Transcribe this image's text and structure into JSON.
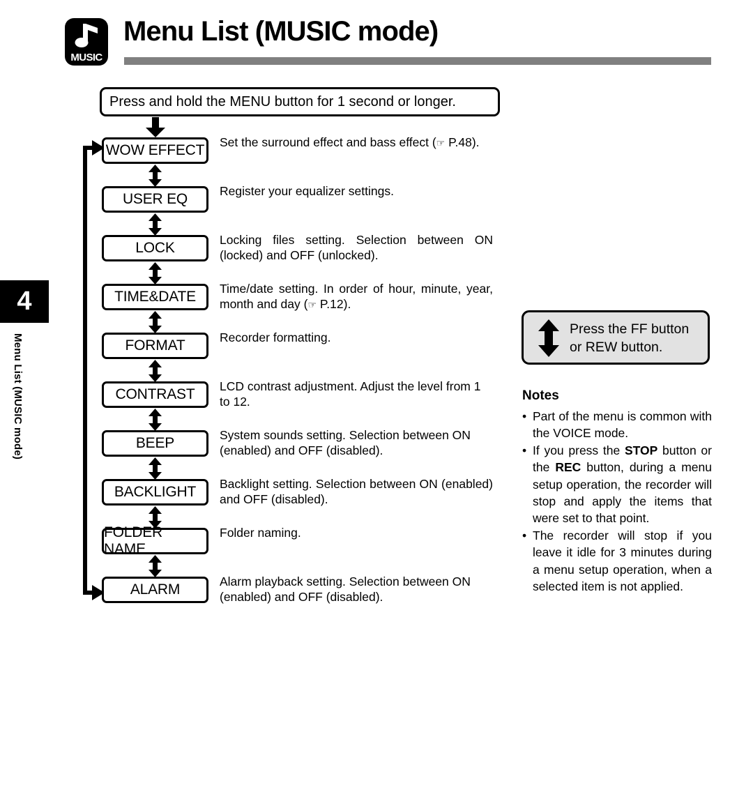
{
  "header": {
    "badge_icon": "music-note-icon",
    "badge_label": "MUSIC",
    "title": "Menu List (MUSIC mode)",
    "rule_color": "#808080"
  },
  "sidebar": {
    "chapter_number": "4",
    "chapter_label": "Menu List (MUSIC mode)",
    "tab_color": "#000000"
  },
  "flow": {
    "intro": "Press and hold the MENU  button for 1 second or longer.",
    "down_arrow_icon": "arrow-down-icon",
    "loop_icon": "loop-arrow-icon",
    "between_icon": "arrow-up-down-icon",
    "items": [
      {
        "label": "WOW EFFECT",
        "description": "Set the surround effect and bass effect (☞ P.48).",
        "justified": true
      },
      {
        "label": "USER EQ",
        "description": "Register your equalizer settings.",
        "justified": false
      },
      {
        "label": "LOCK",
        "description": "Locking files setting. Selection between ON (locked) and OFF (unlocked).",
        "justified": true
      },
      {
        "label": "TIME&DATE",
        "description": "Time/date setting. In order of hour, minute, year, month and day (☞ P.12).",
        "justified": true
      },
      {
        "label": "FORMAT",
        "description": "Recorder formatting.",
        "justified": false
      },
      {
        "label": "CONTRAST",
        "description": "LCD contrast adjustment. Adjust the level from 1 to 12.",
        "justified": false
      },
      {
        "label": "BEEP",
        "description": "System sounds setting. Selection between ON (enabled) and OFF (disabled).",
        "justified": false
      },
      {
        "label": "BACKLIGHT",
        "description": "Backlight setting. Selection between ON (enabled) and OFF (disabled).",
        "justified": true
      },
      {
        "label": "FOLDER NAME",
        "description": "Folder naming.",
        "justified": false
      },
      {
        "label": "ALARM",
        "description": "Alarm playback setting. Selection between ON (enabled) and OFF (disabled).",
        "justified": false
      }
    ]
  },
  "side_panel": {
    "ff_box": {
      "icon": "arrow-up-down-icon",
      "line1": "Press the FF button",
      "line2": "or REW button.",
      "background": "#e2e2e2"
    },
    "notes_title": "Notes",
    "notes": [
      {
        "bullet": "•",
        "parts": [
          {
            "text": "Part of the menu is common with the VOICE mode.",
            "bold": false
          }
        ]
      },
      {
        "bullet": "•",
        "parts": [
          {
            "text": "If you press the ",
            "bold": false
          },
          {
            "text": "STOP",
            "bold": true
          },
          {
            "text": " button or the ",
            "bold": false
          },
          {
            "text": "REC",
            "bold": true
          },
          {
            "text": " button, during a menu setup operation, the recorder will stop and apply the items that were set to that point.",
            "bold": false
          }
        ]
      },
      {
        "bullet": "•",
        "parts": [
          {
            "text": "The recorder will stop if you leave it idle for 3 minutes during a menu setup operation, when a selected item is not applied.",
            "bold": false
          }
        ]
      }
    ]
  }
}
